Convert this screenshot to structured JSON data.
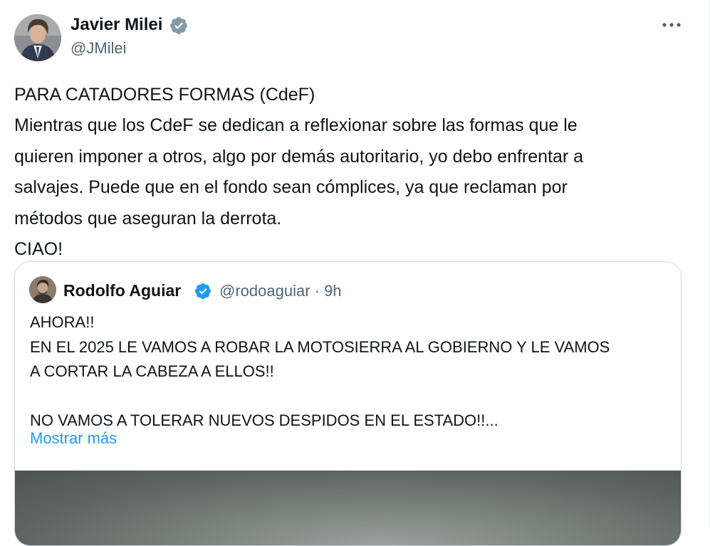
{
  "author": {
    "name": "Javier Milei",
    "handle": "@JMilei",
    "verified": true,
    "avatar_icon": "profile-photo"
  },
  "more_icon": "more-horizontal-icon",
  "tweet": {
    "lines": [
      "PARA CATADORES FORMAS (CdeF)",
      "Mientras que los CdeF se dedican a reflexionar sobre las formas que le",
      "quieren imponer a otros, algo por demás autoritario, yo debo enfrentar a",
      "salvajes. Puede que en el fondo sean cómplices, ya que reclaman por",
      "métodos que aseguran la derrota.",
      "CIAO!"
    ]
  },
  "quoted_tweet": {
    "author_name": "Rodolfo Aguiar",
    "handle_time": "@rodoaguiar · 9h",
    "verified": true,
    "lines": [
      "AHORA!!",
      "EN EL 2025 LE VAMOS A ROBAR LA MOTOSIERRA AL GOBIERNO Y LE VAMOS",
      "A CORTAR LA CABEZA A ELLOS!!",
      "",
      "NO VAMOS A TOLERAR NUEVOS DESPIDOS EN EL ESTADO!!..."
    ],
    "show_more": "Mostrar más"
  },
  "colors": {
    "text": "#0f1419",
    "secondary": "#536471",
    "accent": "#1d9bf0",
    "border": "#cfd9de"
  }
}
